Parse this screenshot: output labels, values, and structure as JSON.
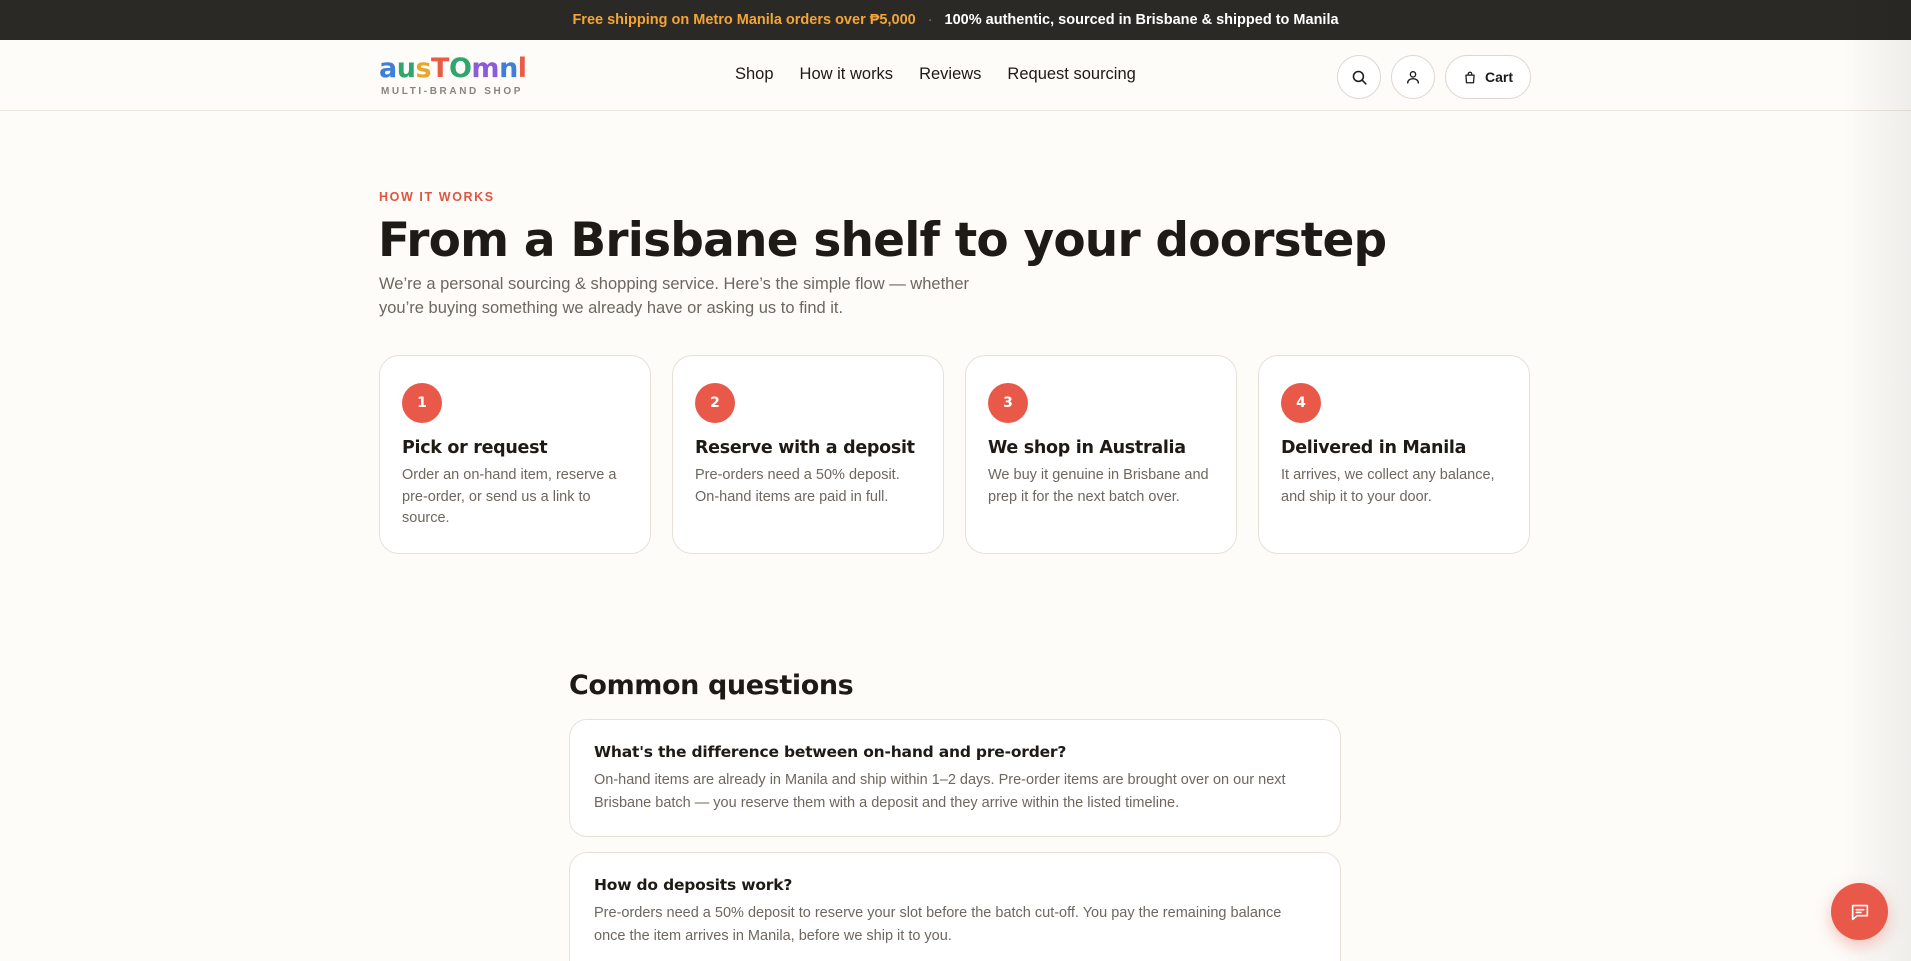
{
  "announcement": {
    "promo": "Free shipping on Metro Manila orders over ₱5,000",
    "separator": "·",
    "note": "100% authentic, sourced in Brisbane & shipped to Manila"
  },
  "brand": {
    "letters": [
      "a",
      "u",
      "s",
      "T",
      "O",
      "m",
      "n",
      "l"
    ],
    "tagline": "MULTI-BRAND SHOP",
    "colors": [
      "#3f7fd9",
      "#2ea66c",
      "#e8a72a",
      "#ea5a45",
      "#8e5bd6"
    ]
  },
  "nav": {
    "items": [
      {
        "label": "Shop"
      },
      {
        "label": "How it works"
      },
      {
        "label": "Reviews"
      },
      {
        "label": "Request sourcing"
      }
    ]
  },
  "header_actions": {
    "search_icon": "search-icon",
    "account_icon": "user-icon",
    "cart_icon": "bag-icon",
    "cart_label": "Cart"
  },
  "hero": {
    "eyebrow": "HOW IT WORKS",
    "title": "From a Brisbane shelf to your doorstep",
    "subtitle": "We’re a personal sourcing & shopping service. Here’s the simple flow — whether you’re buying something we already have or asking us to find it."
  },
  "steps": [
    {
      "number": "1",
      "title": "Pick or request",
      "description": "Order an on-hand item, reserve a pre-order, or send us a link to source."
    },
    {
      "number": "2",
      "title": "Reserve with a deposit",
      "description": "Pre-orders need a 50% deposit. On-hand items are paid in full."
    },
    {
      "number": "3",
      "title": "We shop in Australia",
      "description": "We buy it genuine in Brisbane and prep it for the next batch over."
    },
    {
      "number": "4",
      "title": "Delivered in Manila",
      "description": "It arrives, we collect any balance, and ship it to your door."
    }
  ],
  "faq": {
    "title": "Common questions",
    "items": [
      {
        "question": "What's the difference between on-hand and pre-order?",
        "answer": "On-hand items are already in Manila and ship within 1–2 days. Pre-order items are brought over on our next Brisbane batch — you reserve them with a deposit and they arrive within the listed timeline."
      },
      {
        "question": "How do deposits work?",
        "answer": "Pre-orders need a 50% deposit to reserve your slot before the batch cut-off. You pay the remaining balance once the item arrives in Manila, before we ship it to you."
      }
    ]
  },
  "chat": {
    "icon": "chat-icon"
  },
  "theme": {
    "accent": "#e8594a",
    "dark_bar": "#2b2926",
    "promo_color": "#f4a534"
  }
}
